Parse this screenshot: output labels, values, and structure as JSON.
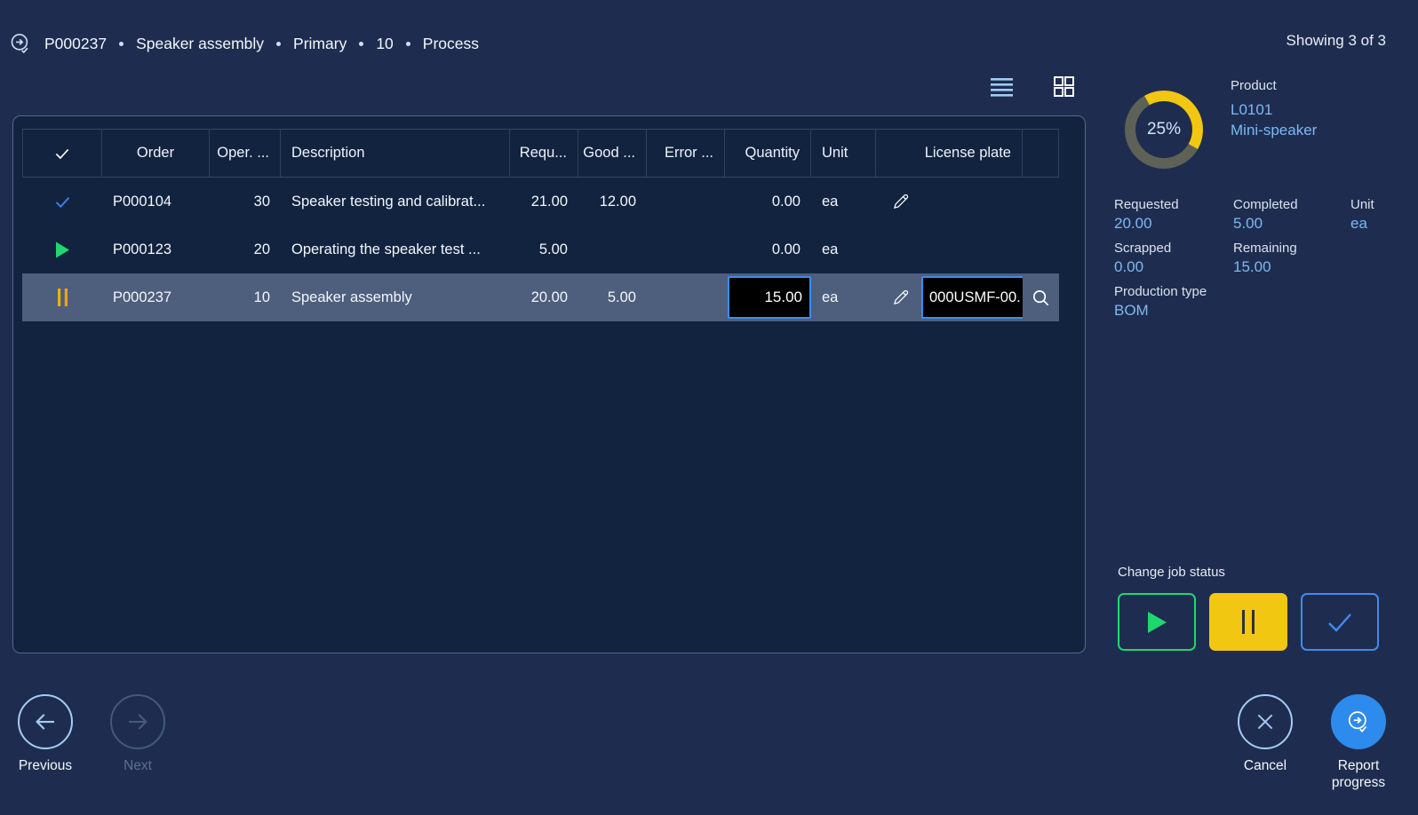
{
  "header": {
    "breadcrumb": [
      "P000237",
      "Speaker assembly",
      "Primary",
      "10",
      "Process"
    ],
    "showing": "Showing 3 of 3"
  },
  "table": {
    "columns": {
      "select": "",
      "order": "Order",
      "oper": "Oper. ...",
      "description": "Description",
      "requested": "Requ...",
      "good": "Good ...",
      "error": "Error ...",
      "quantity": "Quantity",
      "unit": "Unit",
      "license_plate": "License plate"
    },
    "rows": [
      {
        "status": "completed",
        "order": "P000104",
        "oper": "30",
        "description": "Speaker testing and calibrat...",
        "requested": "21.00",
        "good": "12.00",
        "error": "",
        "quantity": "0.00",
        "unit": "ea",
        "license_plate": ""
      },
      {
        "status": "running",
        "order": "P000123",
        "oper": "20",
        "description": "Operating the speaker test ...",
        "requested": "5.00",
        "good": "",
        "error": "",
        "quantity": "0.00",
        "unit": "ea",
        "license_plate": ""
      },
      {
        "status": "paused",
        "order": "P000237",
        "oper": "10",
        "description": "Speaker assembly",
        "requested": "20.00",
        "good": "5.00",
        "error": "",
        "quantity": "15.00",
        "unit": "ea",
        "license_plate": "000USMF-00..."
      }
    ]
  },
  "side_panel": {
    "progress_percent": "25%",
    "product_label": "Product",
    "product_id": "L0101",
    "product_name": "Mini-speaker",
    "stats": [
      {
        "label": "Requested",
        "value": "20.00"
      },
      {
        "label": "Completed",
        "value": "5.00"
      },
      {
        "label": "Unit",
        "value": "ea"
      },
      {
        "label": "Scrapped",
        "value": "0.00"
      },
      {
        "label": "Remaining",
        "value": "15.00"
      },
      {
        "label": "Production type",
        "value": "BOM"
      }
    ],
    "job_status_label": "Change job status"
  },
  "footer": {
    "previous_label": "Previous",
    "next_label": "Next",
    "cancel_label": "Cancel",
    "report_label": "Report progress"
  },
  "icons": {
    "report_progress": "circle-arrow-right-with-check",
    "list_view": "hamburger-lines",
    "grid_view": "grid-2x2",
    "completed": "check",
    "running": "play-triangle",
    "paused": "pause-bars",
    "edit": "pencil",
    "search": "magnifier",
    "previous": "arrow-left",
    "next": "arrow-right",
    "cancel": "x"
  },
  "colors": {
    "background": "#1e2d4f",
    "table_background": "#12233f",
    "selected_row": "#4e5e7d",
    "accent_blue": "#3f8cf0",
    "link_blue": "#7db8f3",
    "green": "#1fd76f",
    "yellow": "#f2c711",
    "donut_track": "#5e6156",
    "report_button": "#2e8bee"
  }
}
